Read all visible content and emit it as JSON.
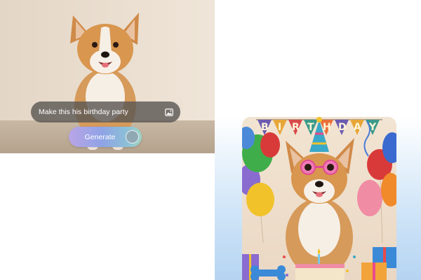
{
  "prompt": {
    "text": "Make this his birthday party",
    "icon": "image-icon"
  },
  "generate": {
    "label": "Generate"
  },
  "result": {
    "banner_letters": [
      "B",
      "I",
      "R",
      "T",
      "H",
      "D",
      "A",
      "Y"
    ]
  },
  "colors": {
    "prompt_bg": "#5c5854",
    "generate_gradient_start": "#b9a5e6",
    "generate_gradient_end": "#a0d4c6",
    "panel_gradient": "#b5d4f2"
  }
}
